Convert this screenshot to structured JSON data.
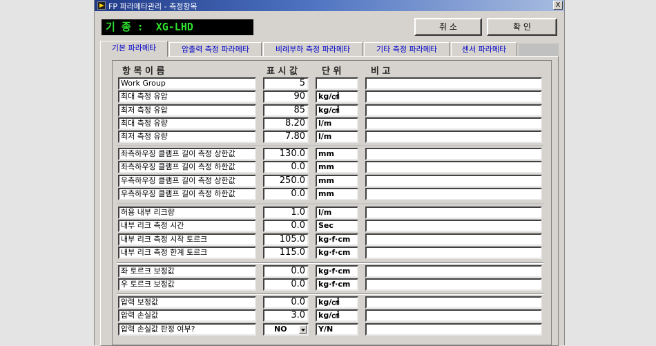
{
  "window": {
    "title": "FP 파라메타관리 - 측정항목",
    "close_label": "X"
  },
  "model": {
    "label": "기 종 :",
    "value": "XG-LHD"
  },
  "buttons": {
    "cancel": "취 소",
    "confirm": "확 인"
  },
  "tabs": [
    {
      "label": "기본 파라메타",
      "active": true
    },
    {
      "label": "압출력 측정 파라메타"
    },
    {
      "label": "비례부하 측정 파라메타"
    },
    {
      "label": "기타 측정 파라메타"
    },
    {
      "label": "센서 파라메타"
    }
  ],
  "headers": {
    "name": "항 목  이 름",
    "value": "표 시 값",
    "unit": "단 위",
    "note": "비 고"
  },
  "groups": [
    [
      {
        "name": "Work Group",
        "value": "5",
        "unit": ""
      },
      {
        "name": "최대 측정 유압",
        "value": "90",
        "unit": "kg/㎠"
      },
      {
        "name": "최저 측정 유압",
        "value": "85",
        "unit": "kg/㎠"
      },
      {
        "name": "최대 측정 유량",
        "value": "8.20",
        "unit": "l/m"
      },
      {
        "name": "최저 측정 유량",
        "value": "7.80",
        "unit": "l/m"
      }
    ],
    [
      {
        "name": "좌측하우징 클램프 길이 측정 상한값",
        "value": "130.0",
        "unit": "mm"
      },
      {
        "name": "좌측하우징 클램프 길이 측정 하한값",
        "value": "0.0",
        "unit": "mm"
      },
      {
        "name": "우측하우징 클램프 길이 측정 상한값",
        "value": "250.0",
        "unit": "mm"
      },
      {
        "name": "우측하우징 클램프 길이 측정 하한값",
        "value": "0.0",
        "unit": "mm"
      }
    ],
    [
      {
        "name": "허용 내부 리크량",
        "value": "1.0",
        "unit": "l/m"
      },
      {
        "name": "내부 리크 측정 시간",
        "value": "0.0",
        "unit": "Sec"
      },
      {
        "name": "내부 리크 측정 시작 토르크",
        "value": "105.0",
        "unit": "kg·f·cm"
      },
      {
        "name": "내부 리크 측정 한계 토르크",
        "value": "115.0",
        "unit": "kg·f·cm"
      }
    ],
    [
      {
        "name": "좌 토르크 보정값",
        "value": "0.0",
        "unit": "kg·f·cm"
      },
      {
        "name": "우 토르크 보정값",
        "value": "0.0",
        "unit": "kg·f·cm"
      }
    ],
    [
      {
        "name": "압력 보정값",
        "value": "0.0",
        "unit": "kg/㎠"
      },
      {
        "name": "압력 손실값",
        "value": "3.0",
        "unit": "kg/㎠"
      },
      {
        "name": "압력 손실값 판정 여부?",
        "value": "NO",
        "unit": "Y/N",
        "type": "select"
      }
    ]
  ]
}
